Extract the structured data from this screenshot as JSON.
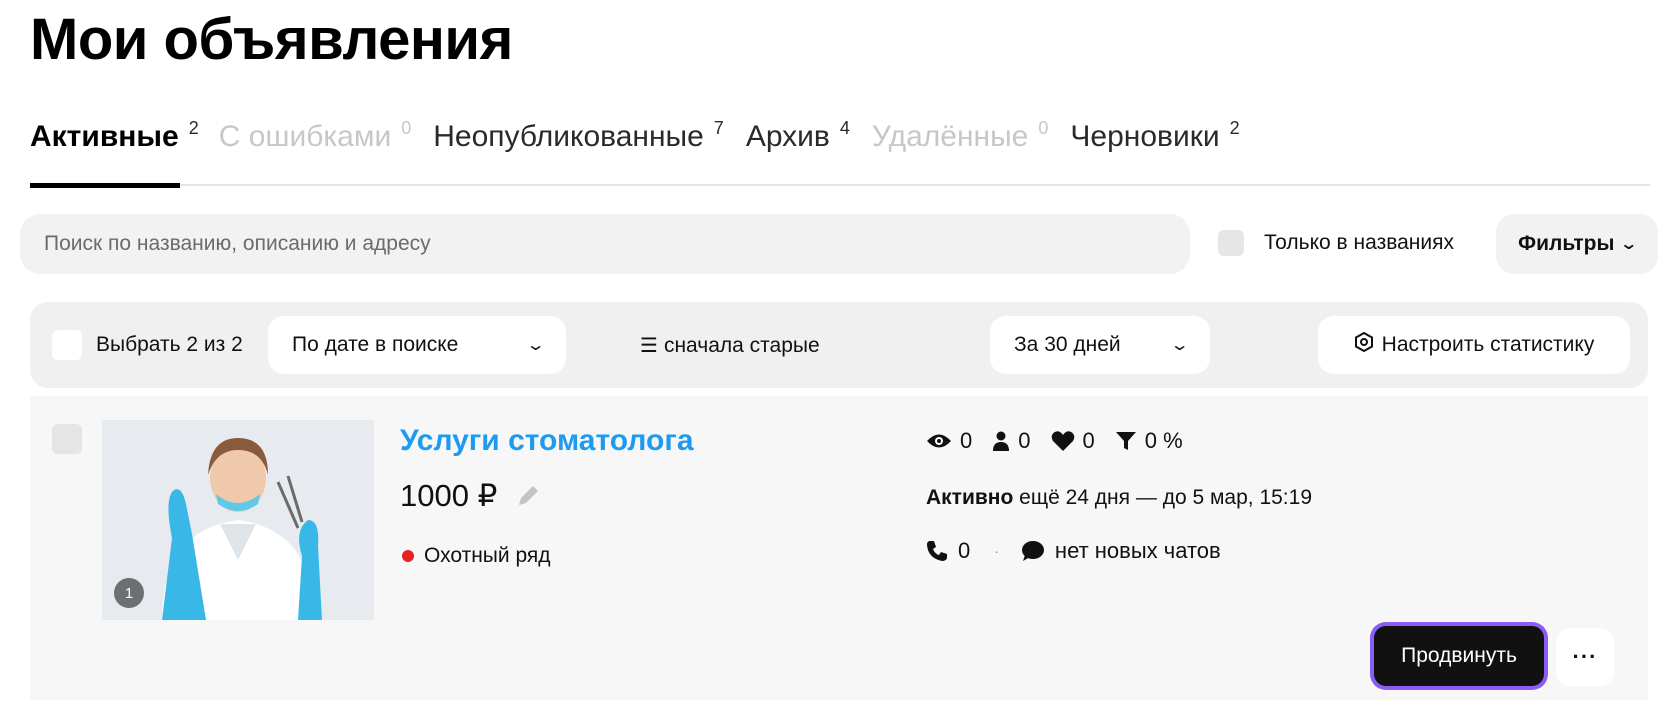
{
  "page": {
    "title": "Мои объявления"
  },
  "tabs": [
    {
      "label": "Активные",
      "count": "2",
      "state": "active"
    },
    {
      "label": "С ошибками",
      "count": "0",
      "state": "disabled"
    },
    {
      "label": "Неопубликованные",
      "count": "7",
      "state": "normal"
    },
    {
      "label": "Архив",
      "count": "4",
      "state": "normal"
    },
    {
      "label": "Удалённые",
      "count": "0",
      "state": "disabled"
    },
    {
      "label": "Черновики",
      "count": "2",
      "state": "normal"
    }
  ],
  "search": {
    "placeholder": "Поиск по названию, описанию и адресу",
    "value": "",
    "only_names_label": "Только в названиях",
    "only_names_checked": false,
    "filters_label": "Фильтры",
    "filters_icon": "chevron-down-icon"
  },
  "toolbar": {
    "select_label": "Выбрать 2 из 2",
    "sort_by": "По дате в поиске",
    "sort_order": "сначала старые",
    "sort_order_icon": "sort-lines-icon",
    "period": "За 30 дней",
    "stats_label": "Настроить статистику",
    "stats_icon": "hexagon-settings-icon"
  },
  "listing": {
    "title": "Услуги стоматолога",
    "price": "1000 ₽",
    "photo_count": "1",
    "metro_station": "Охотный ряд",
    "metro_color": "#e52421",
    "stats": {
      "views": "0",
      "contacts": "0",
      "favorites": "0",
      "conversion": "0 %"
    },
    "status_word": "Активно",
    "status_detail": "ещё 24 дня — до 5 мар, 15:19",
    "calls": "0",
    "chats": "нет новых чатов",
    "promote_label": "Продвинуть",
    "more_label": "···"
  },
  "colors": {
    "title_link": "#1d9bf0",
    "promote_bg": "#111111",
    "promote_outline": "#8b5cf6"
  }
}
